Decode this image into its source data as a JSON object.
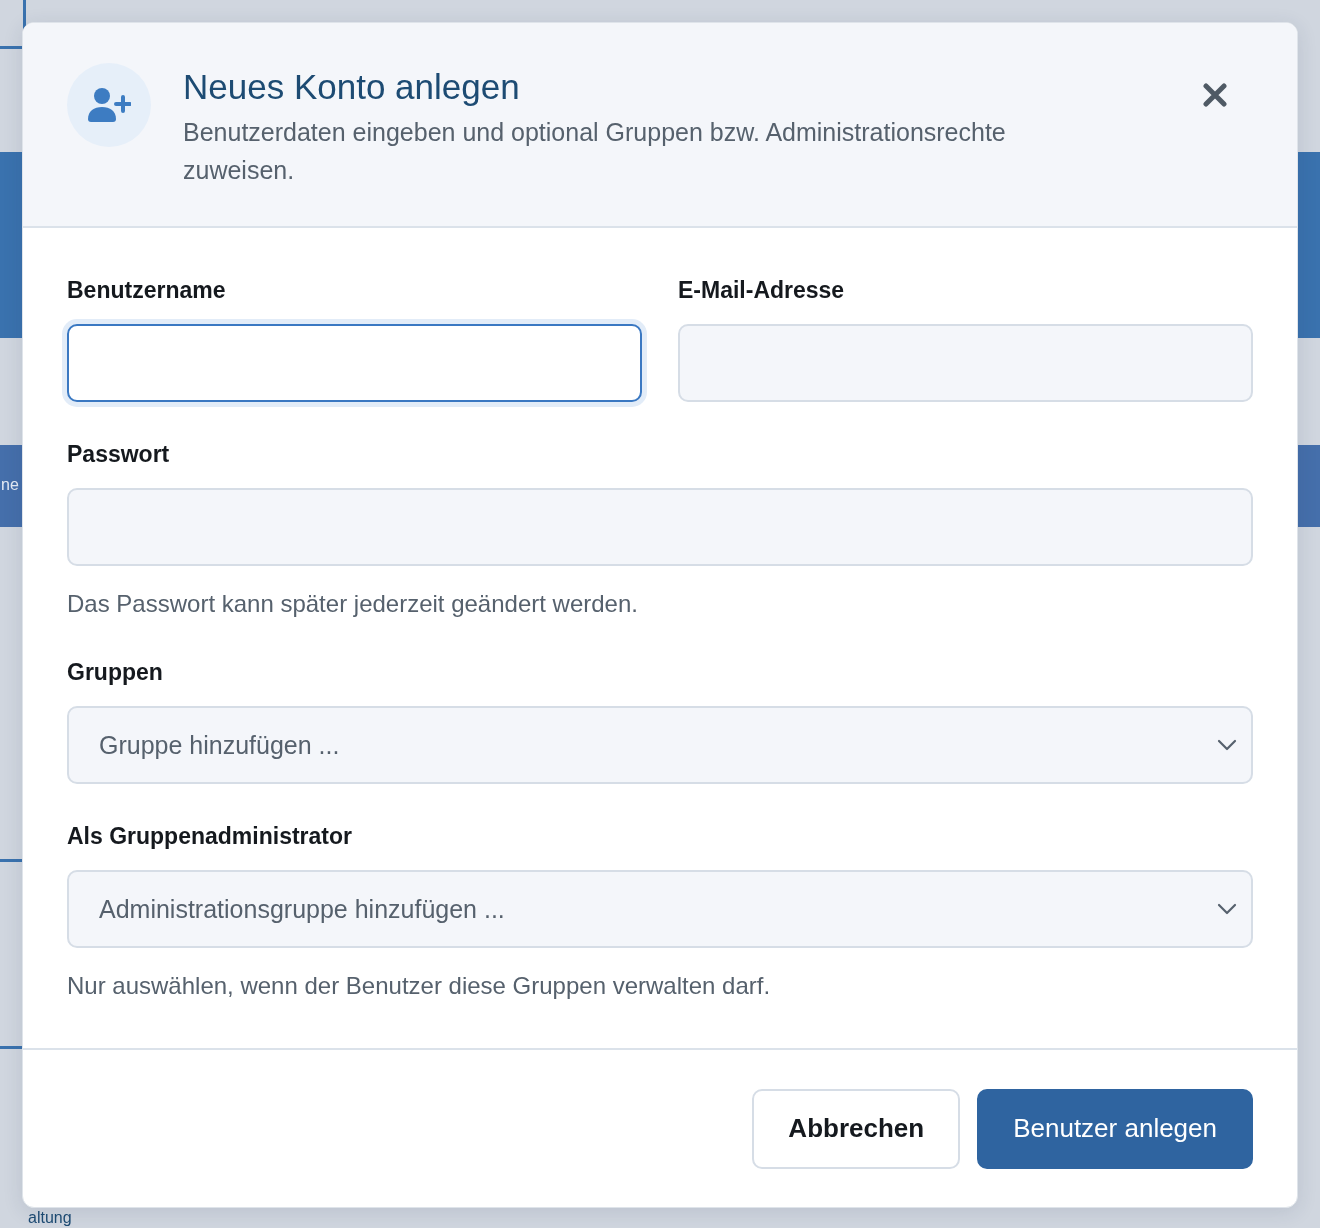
{
  "background": {
    "texts": [
      "ne",
      "altung"
    ]
  },
  "dialog": {
    "title": "Neues Konto anlegen",
    "subtitle": "Benutzerdaten eingeben und optional Gruppen bzw. Administrationsrechte zuweisen.",
    "fields": [
      {
        "label": "Benutzername",
        "kind": "text",
        "focused": true
      },
      {
        "label": "E-Mail-Adresse",
        "kind": "text",
        "focused": false
      },
      {
        "label": "Passwort",
        "kind": "password",
        "focused": false,
        "hint": "Das Passwort kann später jederzeit geändert werden."
      },
      {
        "label": "Gruppen",
        "kind": "select",
        "focused": false,
        "placeholder": "Gruppe hinzufügen ..."
      },
      {
        "label": "Als Gruppenadministrator",
        "kind": "select",
        "focused": false,
        "placeholder": "Administrationsgruppe hinzufügen ...",
        "hint": "Nur auswählen, wenn der Benutzer diese Gruppen verwalten darf."
      }
    ],
    "buttons": [
      {
        "label": "Abbrechen",
        "kind": "secondary"
      },
      {
        "label": "Benutzer anlegen",
        "kind": "primary"
      }
    ]
  }
}
